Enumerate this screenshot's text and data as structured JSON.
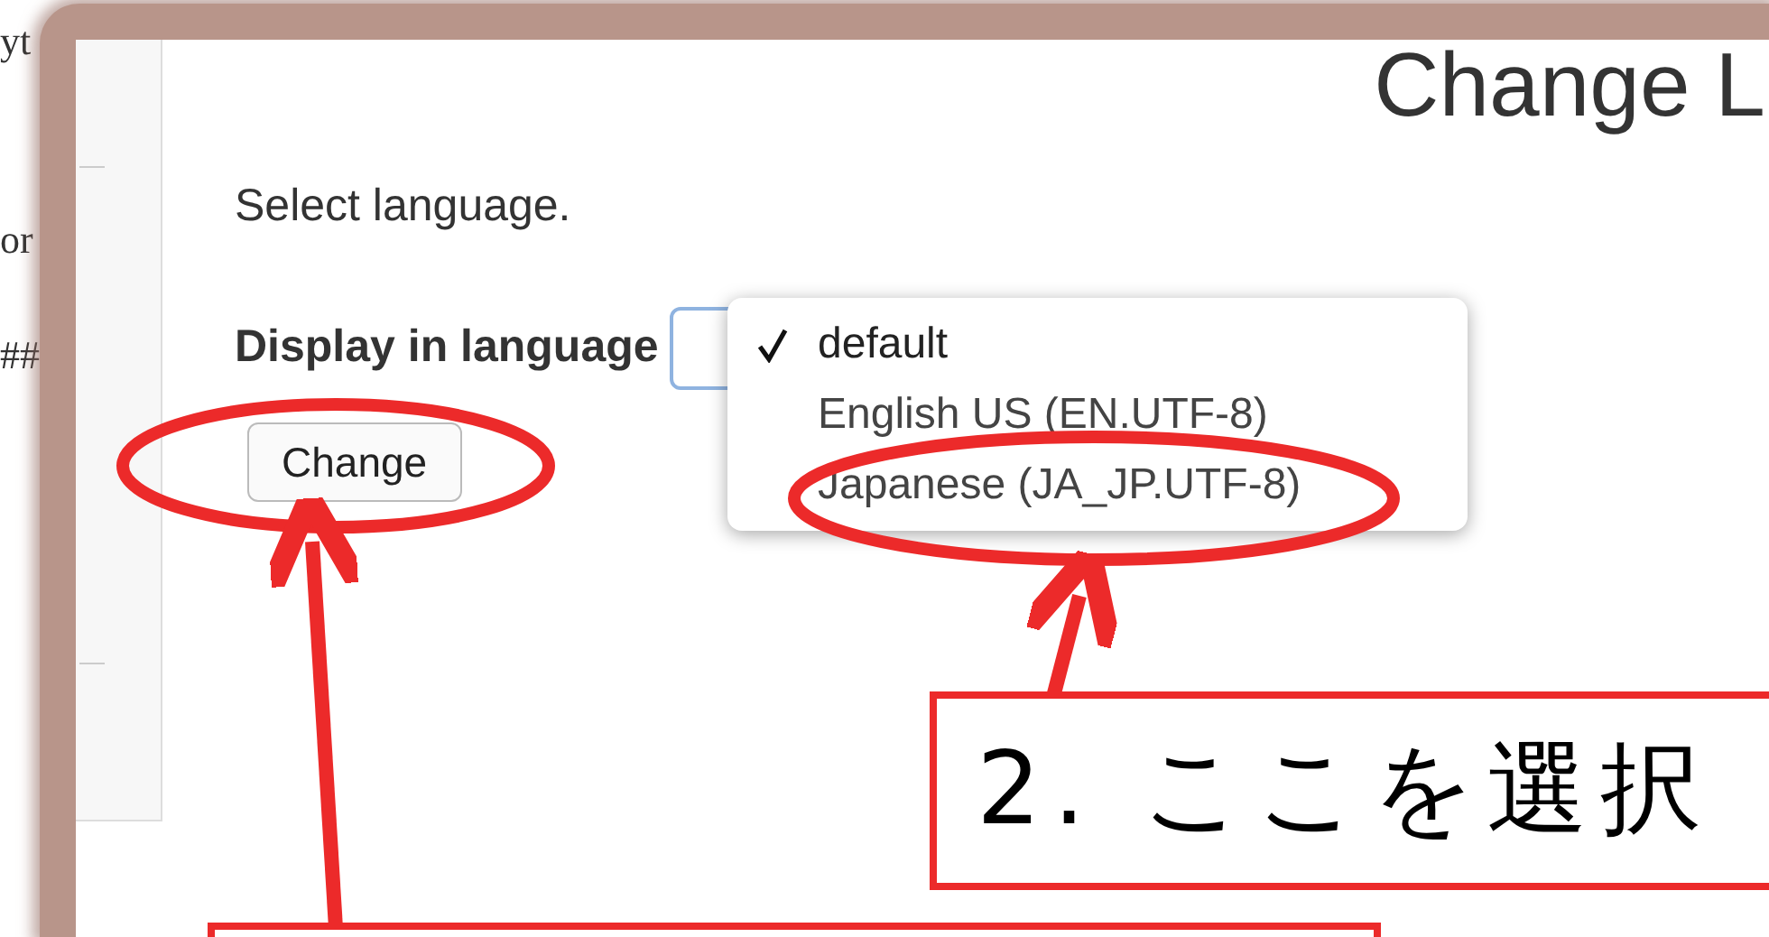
{
  "background_texts": [
    "yt",
    "or",
    "##"
  ],
  "title": "Change L",
  "instruction": "Select language.",
  "field_label": "Display in language",
  "dropdown": {
    "options": [
      {
        "label": "default",
        "selected": true
      },
      {
        "label": "English US (EN.UTF-8)",
        "selected": false
      },
      {
        "label": "Japanese (JA_JP.UTF-8)",
        "selected": false
      }
    ]
  },
  "button": "Change",
  "callout": "2. ここを選択"
}
